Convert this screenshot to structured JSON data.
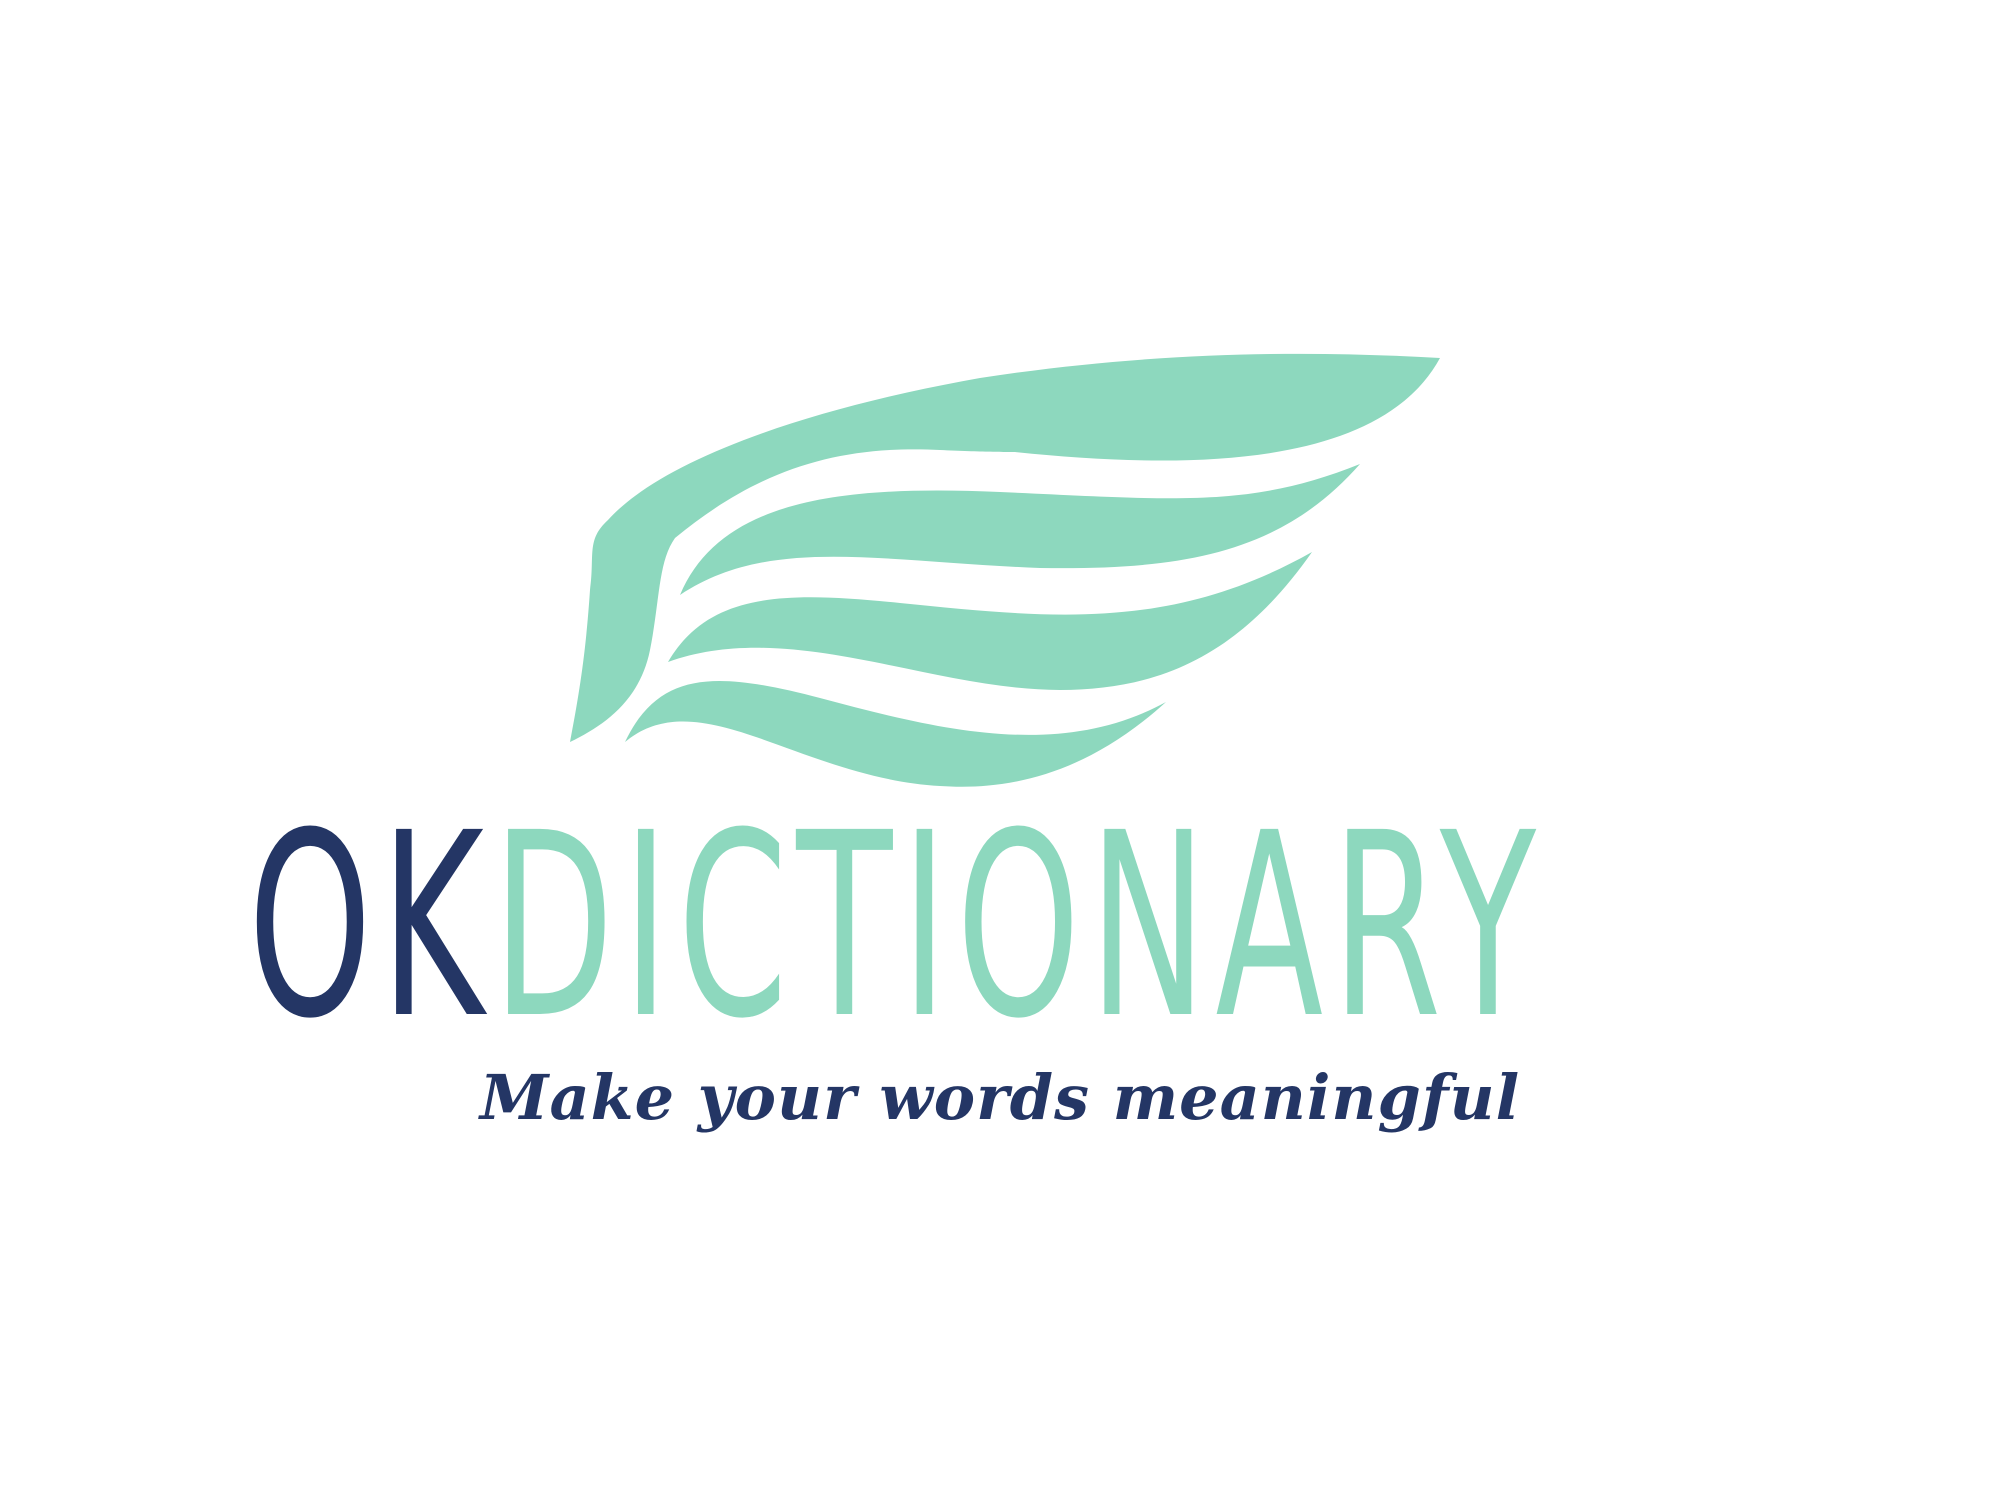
{
  "logo": {
    "icon": "wing-icon",
    "wordmark_ok": "OK",
    "wordmark_rest": "DICTIONARY",
    "tagline": "Make your words meaningful"
  },
  "colors": {
    "primary_navy": "#243665",
    "accent_mint": "#8dd8be",
    "background": "#ffffff"
  }
}
